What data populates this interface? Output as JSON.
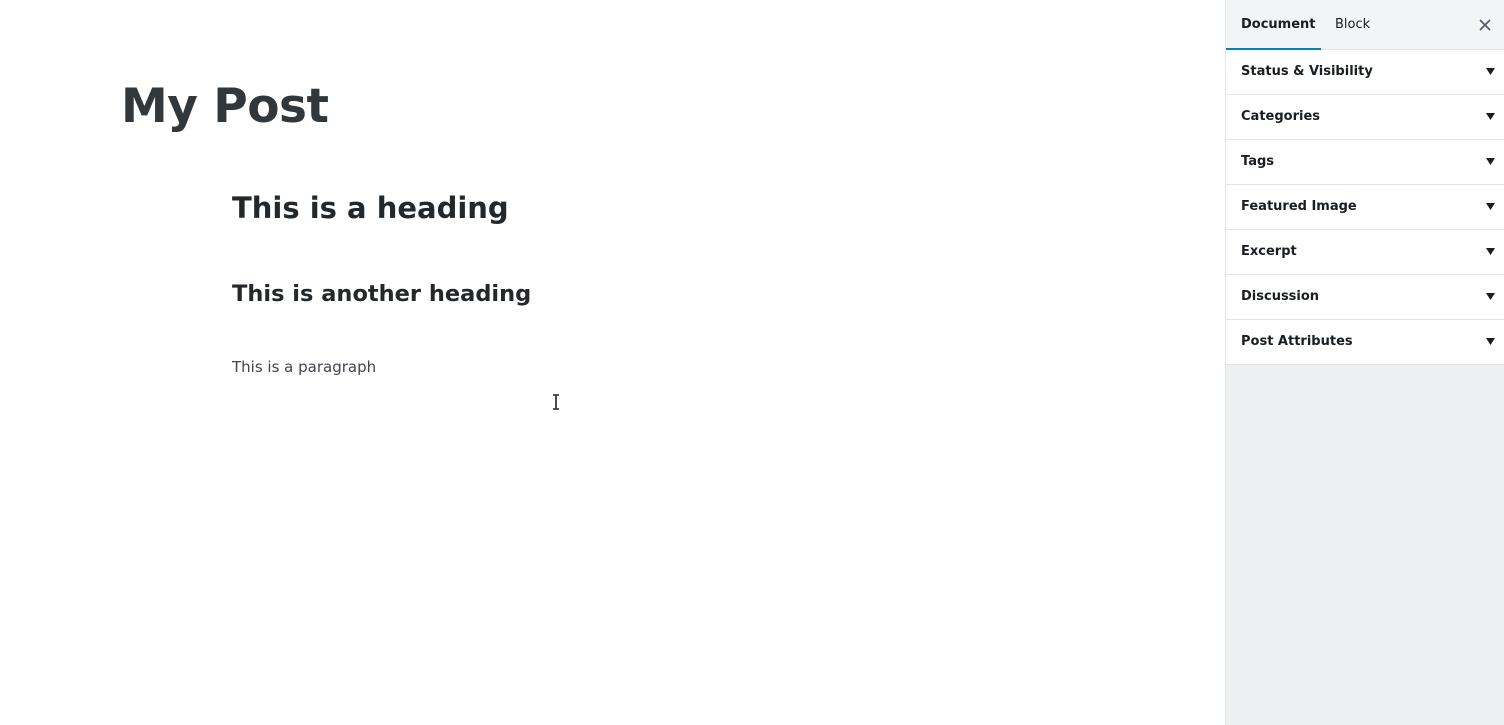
{
  "editor": {
    "post_title": "My Post",
    "blocks": [
      {
        "type": "heading",
        "text": "This is a heading"
      },
      {
        "type": "heading",
        "text": "This is another heading"
      },
      {
        "type": "paragraph",
        "text": "This is a paragraph"
      }
    ]
  },
  "sidebar": {
    "tabs": [
      {
        "label": "Document",
        "active": true
      },
      {
        "label": "Block",
        "active": false
      }
    ],
    "close_icon": "close-icon",
    "panels": [
      {
        "label": "Status & Visibility",
        "icon": "arrow-down-icon"
      },
      {
        "label": "Categories",
        "icon": "arrow-down-icon"
      },
      {
        "label": "Tags",
        "icon": "arrow-down-icon"
      },
      {
        "label": "Featured Image",
        "icon": "arrow-down-icon"
      },
      {
        "label": "Excerpt",
        "icon": "arrow-down-icon"
      },
      {
        "label": "Discussion",
        "icon": "arrow-down-icon"
      },
      {
        "label": "Post Attributes",
        "icon": "arrow-down-icon"
      }
    ]
  },
  "colors": {
    "accent": "#0085ba",
    "sidebar_bg": "#edeff0",
    "text": "#23282d"
  }
}
